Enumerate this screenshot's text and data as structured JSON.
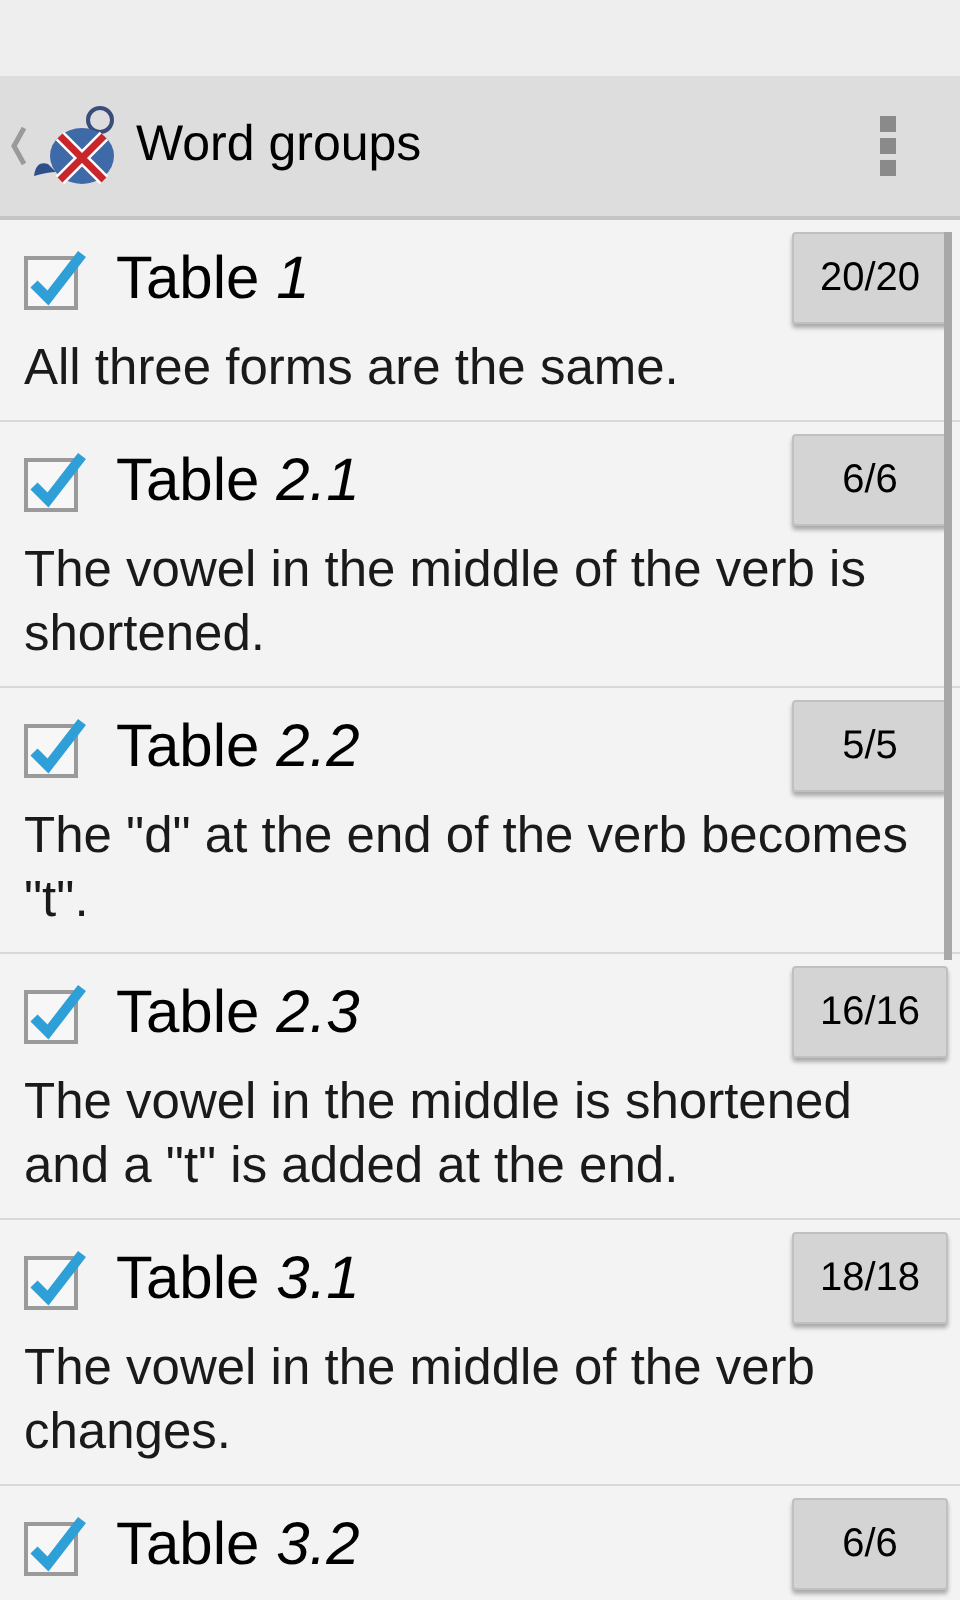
{
  "action_bar": {
    "title": "Word groups"
  },
  "groups": [
    {
      "title": "Table *1*",
      "checked": true,
      "count": "20/20",
      "description": "All three forms are the same."
    },
    {
      "title": "Table *2.1*",
      "checked": true,
      "count": "6/6",
      "description": "The vowel in the middle of the verb is shortened."
    },
    {
      "title": "Table *2.2*",
      "checked": true,
      "count": "5/5",
      "description": "The \"d\" at the end of the verb becomes \"t\"."
    },
    {
      "title": "Table *2.3*",
      "checked": true,
      "count": "16/16",
      "description": "The vowel in the middle is shortened and a \"t\" is added at the end."
    },
    {
      "title": "Table *3.1*",
      "checked": true,
      "count": "18/18",
      "description": "The vowel in the middle of the verb changes."
    },
    {
      "title": "Table *3.2*",
      "checked": true,
      "count": "6/6"
    }
  ]
}
